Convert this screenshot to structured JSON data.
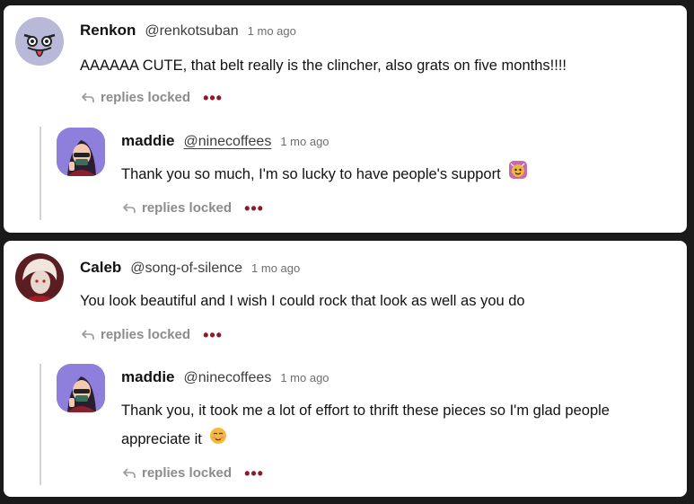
{
  "comments": [
    {
      "name": "Renkon",
      "handle": "@renkotsuban",
      "time": "1 mo ago",
      "text": "AAAAAA CUTE, that belt really is the clincher, also grats on five months!!!!",
      "replies_label": "replies locked",
      "more_label": "•••",
      "reply": {
        "name": "maddie",
        "handle": "@ninecoffees",
        "time": "1 mo ago",
        "text": "Thank you so much, I'm so lucky to have people's support",
        "replies_label": "replies locked",
        "more_label": "•••"
      }
    },
    {
      "name": "Caleb",
      "handle": "@song-of-silence",
      "time": "1 mo ago",
      "text": "You look beautiful and I wish I could rock that look as well as you do",
      "replies_label": "replies locked",
      "more_label": "•••",
      "reply": {
        "name": "maddie",
        "handle": "@ninecoffees",
        "time": "1 mo ago",
        "text_line1": "Thank you, it took me a lot of effort to thrift these pieces so I'm glad people",
        "text_line2": "appreciate it",
        "replies_label": "replies locked",
        "more_label": "•••"
      }
    }
  ],
  "icons": {
    "reply": "reply-arrow-icon",
    "more": "more-dots-icon",
    "emoji1": "party-face-emoji",
    "emoji2": "relieved-face-emoji"
  },
  "colors": {
    "accent_dots": "#8b1a2f",
    "muted": "#8c8c8c",
    "background": "#1a1a1a"
  }
}
